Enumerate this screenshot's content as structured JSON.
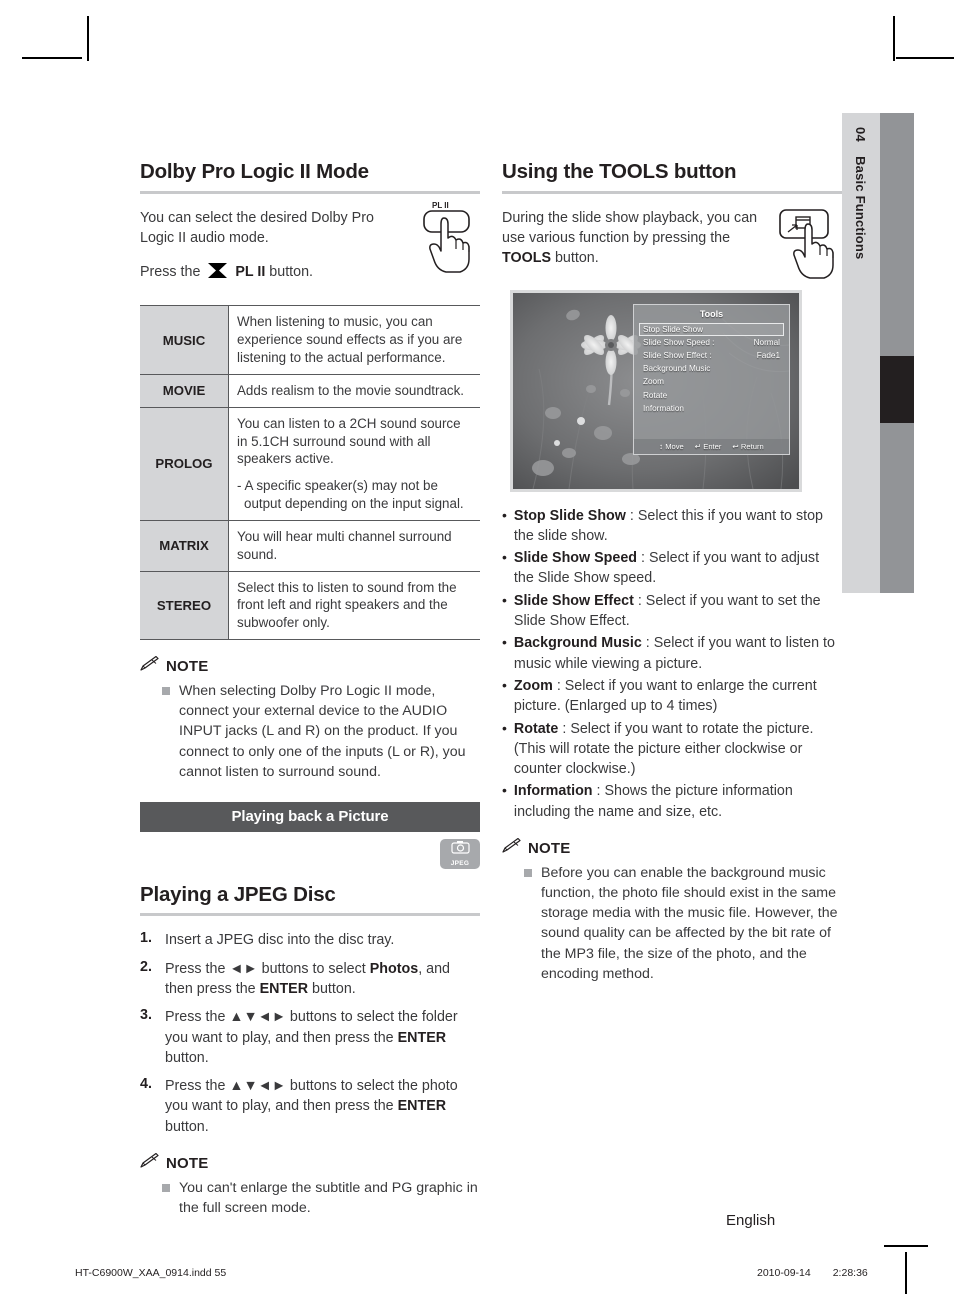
{
  "side_tab": {
    "chapter_number": "04",
    "chapter_title": "Basic Functions"
  },
  "left_column": {
    "heading": "Dolby Pro Logic II Mode",
    "intro_line1": "You can select the desired Dolby Pro",
    "intro_line2": "Logic II audio mode.",
    "press_prefix": "Press the",
    "press_button": "PL II",
    "press_suffix": "button.",
    "button_graphic_label": "PL II",
    "modes": [
      {
        "name": "MUSIC",
        "desc": "When listening to music, you can experience sound effects as if you are listening to the actual performance.",
        "sub": ""
      },
      {
        "name": "MOVIE",
        "desc": "Adds realism to the movie soundtrack.",
        "sub": ""
      },
      {
        "name": "PROLOG",
        "desc": "You can listen to a 2CH sound source in 5.1CH surround sound with all speakers active.",
        "sub": "- A specific speaker(s) may not be output depending on the input signal."
      },
      {
        "name": "MATRIX",
        "desc": "You will hear multi channel surround sound.",
        "sub": ""
      },
      {
        "name": "STEREO",
        "desc": "Select this to listen to sound from the front left and right speakers and the subwoofer only.",
        "sub": ""
      }
    ],
    "note1_label": "NOTE",
    "note1_item": "When selecting Dolby Pro Logic II mode, connect your external device to the AUDIO INPUT jacks (L and R) on the product. If you connect to only one of the inputs (L or R), you cannot listen to surround sound.",
    "section_bar": "Playing back a Picture",
    "jpeg_badge_label": "JPEG",
    "jpeg_heading": "Playing a JPEG Disc",
    "steps": [
      {
        "num": "1.",
        "text": "Insert a JPEG disc into the disc tray."
      },
      {
        "num": "2.",
        "text": "Press the ◄► buttons to select <b>Photos</b>, and then press the <b>ENTER</b> button."
      },
      {
        "num": "3.",
        "text": "Press the ▲▼◄► buttons to select the folder you want to play, and then press the <b>ENTER</b> button."
      },
      {
        "num": "4.",
        "text": "Press the ▲▼◄► buttons to select the photo you want to play, and then press the <b>ENTER</b> button."
      }
    ],
    "note2_label": "NOTE",
    "note2_item": "You can't enlarge the subtitle and PG graphic in the full screen mode."
  },
  "right_column": {
    "heading": "Using the TOOLS button",
    "intro": "During the slide show playback, you can use various function by pressing the <b>TOOLS</b> button.",
    "tv_screen": {
      "menu_title": "Tools",
      "rows": [
        {
          "label": "Stop Slide Show",
          "value": "",
          "selected": true
        },
        {
          "label": "Slide Show Speed :",
          "value": "Normal",
          "selected": false
        },
        {
          "label": "Slide Show Effect :",
          "value": "Fade1",
          "selected": false
        },
        {
          "label": "Background Music",
          "value": "",
          "selected": false
        },
        {
          "label": "Zoom",
          "value": "",
          "selected": false
        },
        {
          "label": "Rotate",
          "value": "",
          "selected": false
        },
        {
          "label": "Information",
          "value": "",
          "selected": false
        }
      ],
      "footer": [
        {
          "icon": "↕",
          "label": "Move"
        },
        {
          "icon": "↵",
          "label": "Enter"
        },
        {
          "icon": "↩",
          "label": "Return"
        }
      ]
    },
    "bullets": [
      {
        "term": "Stop Slide Show",
        "desc": ": Select this if you want to stop the slide show."
      },
      {
        "term": "Slide Show Speed",
        "desc": ": Select if you want to adjust the Slide Show speed."
      },
      {
        "term": "Slide Show Effect",
        "desc": ": Select if you want to set the Slide Show Effect."
      },
      {
        "term": "Background Music",
        "desc": ": Select if you want to listen to music while viewing a picture."
      },
      {
        "term": "Zoom",
        "desc": ": Select if you want to enlarge the current picture. (Enlarged up to 4 times)"
      },
      {
        "term": "Rotate",
        "desc": ": Select if you want to rotate the picture. (This will rotate the picture either clockwise or counter clockwise.)"
      },
      {
        "term": "Information",
        "desc": ": Shows the picture information including the name and size, etc."
      }
    ],
    "note_label": "NOTE",
    "note_item": "Before you can enable the background music function, the photo file should exist in the same storage media with the music file. However, the sound quality can be affected by the bit rate of the MP3 file, the size of the photo, and the encoding method."
  },
  "footer": {
    "language": "English",
    "file_name": "HT-C6900W_XAA_0914.indd   55",
    "date": "2010-09-14",
    "time": "2:28:36"
  },
  "colors": {
    "text": "#231f20",
    "body_text": "#3a3a3c",
    "table_header_bg": "#d4d5d7",
    "section_bar_bg": "#58595b",
    "rule": "#c8c9cb",
    "tab_grey": "#929497",
    "tab_light": "#d4d5d7",
    "badge_grey": "#a7a9ac"
  }
}
